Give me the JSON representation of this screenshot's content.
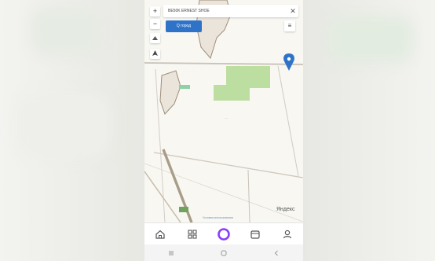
{
  "search": {
    "value": "BE50K ERNEST SHOE"
  },
  "map_controls": {
    "zoom_in": "+",
    "zoom_out": "−",
    "clear": "✕",
    "menu": "≡"
  },
  "route_button": {
    "label": "Q город"
  },
  "map_footer": {
    "brand": "Яндекс",
    "attribution": "Условия использования"
  },
  "bottom_nav": {
    "items": [
      {
        "name": "home-icon"
      },
      {
        "name": "services-grid-icon"
      },
      {
        "name": "alice-assistant-icon"
      },
      {
        "name": "wallet-icon"
      },
      {
        "name": "profile-icon"
      }
    ]
  },
  "system_nav": {
    "items": [
      "recent-apps-icon",
      "home-circle-icon",
      "back-icon"
    ]
  },
  "colors": {
    "accent": "#2f73c8",
    "map_background": "#f8f7f2",
    "park": "#b9dc9c",
    "alice": "#8a3ffc"
  }
}
